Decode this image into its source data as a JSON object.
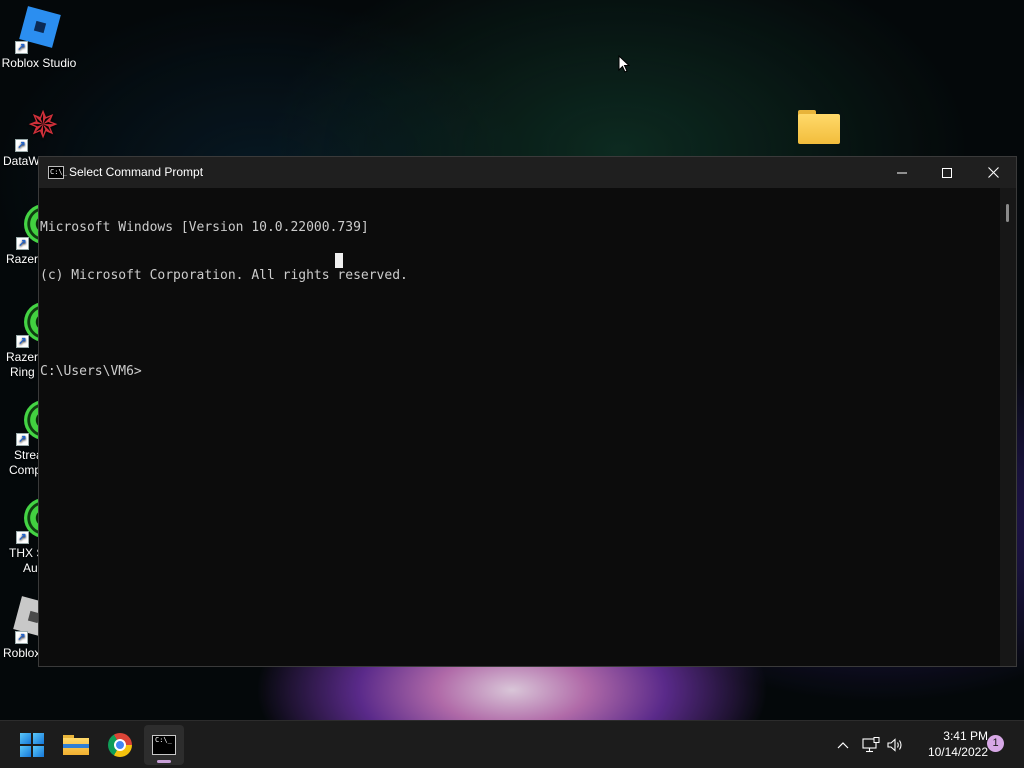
{
  "desktop": {
    "icons": [
      {
        "label": "Roblox Studio",
        "icon": "roblox-studio-icon"
      },
      {
        "label": "DataW",
        "icon": "datawing-icon"
      },
      {
        "label": "Razer (",
        "icon": "razer-icon"
      },
      {
        "label": "Razer \\",
        "label2": "Ring",
        "icon": "razer-icon"
      },
      {
        "label": "Strea",
        "label2": "Comp",
        "icon": "razer-icon"
      },
      {
        "label": "THX S",
        "label2": "Au",
        "icon": "razer-icon"
      },
      {
        "label": "Roblox",
        "icon": "roblox-icon"
      }
    ],
    "shortcut_glyph": "↗"
  },
  "cmd": {
    "title": "Select Command Prompt",
    "icon_glyph": "C:\\_",
    "lines": [
      "Microsoft Windows [Version 10.0.22000.739]",
      "(c) Microsoft Corporation. All rights reserved.",
      "",
      "C:\\Users\\VM6>"
    ]
  },
  "taskbar": {
    "cmd_icon_glyph": "C:\\_",
    "time": "3:41 PM",
    "date": "10/14/2022",
    "notification_count": "1"
  },
  "colors": {
    "terminal_bg": "#0c0c0c",
    "terminal_text": "#cccccc",
    "titlebar_bg": "#1f1f1f",
    "taskbar_bg": "#1c1c1c",
    "accent": "#c8a0d8"
  }
}
